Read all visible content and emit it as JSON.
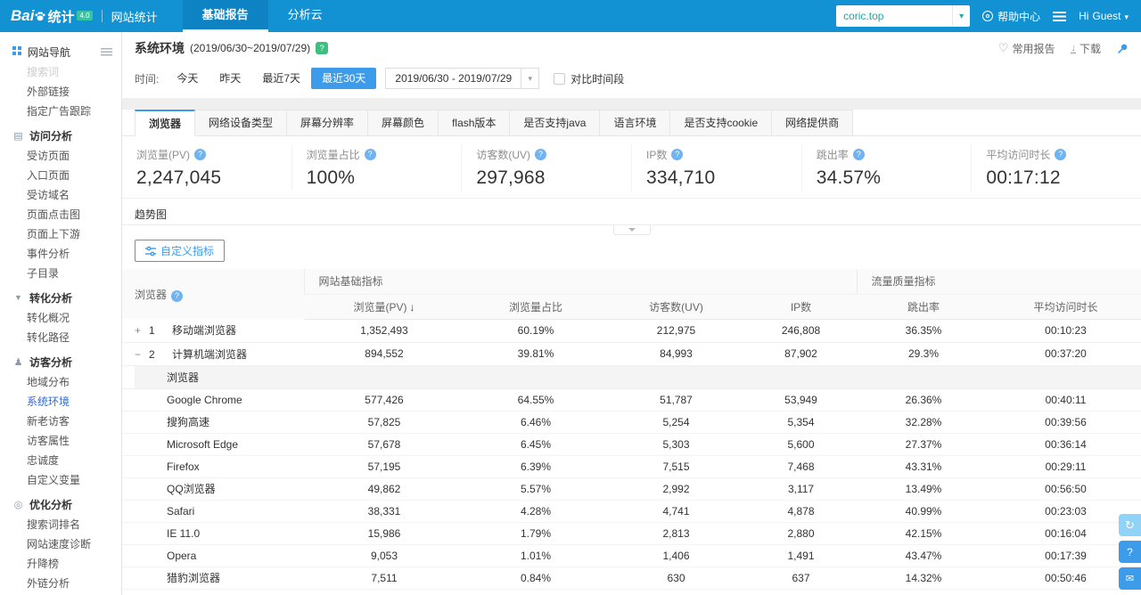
{
  "colors": {
    "header_bg": "#1292d2",
    "accent": "#3d9ce9",
    "link": "#2f6ce0",
    "green_badge": "#3fbf7f"
  },
  "header": {
    "logo_bai": "Bai",
    "logo_tongji": "统计",
    "version": "4.0",
    "product": "网站统计",
    "nav": [
      {
        "label": "基础报告",
        "active": true
      },
      {
        "label": "分析云",
        "active": false
      }
    ],
    "site": "coric.top",
    "help_center": "帮助中心",
    "greeting": "Hi",
    "user": "Guest"
  },
  "sidebar": {
    "title": "网站导航",
    "sections": [
      {
        "header": "",
        "icon": "",
        "items": [
          {
            "label": "搜索词",
            "muted": true
          },
          {
            "label": "外部链接"
          },
          {
            "label": "指定广告跟踪"
          }
        ]
      },
      {
        "header": "访问分析",
        "icon": "monitor",
        "items": [
          {
            "label": "受访页面"
          },
          {
            "label": "入口页面"
          },
          {
            "label": "受访域名"
          },
          {
            "label": "页面点击图"
          },
          {
            "label": "页面上下游"
          },
          {
            "label": "事件分析"
          },
          {
            "label": "子目录"
          }
        ]
      },
      {
        "header": "转化分析",
        "icon": "funnel",
        "items": [
          {
            "label": "转化概况"
          },
          {
            "label": "转化路径"
          }
        ]
      },
      {
        "header": "访客分析",
        "icon": "person",
        "items": [
          {
            "label": "地域分布"
          },
          {
            "label": "系统环境",
            "active": true
          },
          {
            "label": "新老访客"
          },
          {
            "label": "访客属性"
          },
          {
            "label": "忠诚度"
          },
          {
            "label": "自定义变量"
          }
        ]
      },
      {
        "header": "优化分析",
        "icon": "target",
        "items": [
          {
            "label": "搜索词排名"
          },
          {
            "label": "网站速度诊断"
          },
          {
            "label": "升降榜"
          },
          {
            "label": "外链分析"
          }
        ]
      }
    ]
  },
  "page": {
    "title": "系统环境",
    "date_range": "(2019/06/30~2019/07/29)",
    "fav_report": "常用报告",
    "download": "下载"
  },
  "filters": {
    "label": "时间:",
    "options": [
      {
        "label": "今天"
      },
      {
        "label": "昨天"
      },
      {
        "label": "最近7天"
      },
      {
        "label": "最近30天",
        "active": true
      }
    ],
    "date_value": "2019/06/30 - 2019/07/29",
    "compare": "对比时间段"
  },
  "tabs": [
    {
      "label": "浏览器",
      "active": true
    },
    {
      "label": "网络设备类型"
    },
    {
      "label": "屏幕分辨率"
    },
    {
      "label": "屏幕颜色"
    },
    {
      "label": "flash版本"
    },
    {
      "label": "是否支持java"
    },
    {
      "label": "语言环境"
    },
    {
      "label": "是否支持cookie"
    },
    {
      "label": "网络提供商"
    }
  ],
  "metrics": [
    {
      "label": "浏览量(PV)",
      "value": "2,247,045"
    },
    {
      "label": "浏览量占比",
      "value": "100%"
    },
    {
      "label": "访客数(UV)",
      "value": "297,968"
    },
    {
      "label": "IP数",
      "value": "334,710"
    },
    {
      "label": "跳出率",
      "value": "34.57%"
    },
    {
      "label": "平均访问时长",
      "value": "00:17:12"
    }
  ],
  "trend": {
    "label": "趋势图"
  },
  "custom_metric": {
    "label": "自定义指标"
  },
  "table": {
    "dim_header": "浏览器",
    "groups": [
      {
        "label": "网站基础指标",
        "span": 4
      },
      {
        "label": "流量质量指标",
        "span": 2
      }
    ],
    "columns": [
      {
        "label": "浏览量(PV)",
        "sorted": true
      },
      {
        "label": "浏览量占比"
      },
      {
        "label": "访客数(UV)"
      },
      {
        "label": "IP数"
      },
      {
        "label": "跳出率"
      },
      {
        "label": "平均访问时长"
      }
    ],
    "rows": [
      {
        "expand": "+",
        "rank": "1",
        "name": "移动端浏览器",
        "values": [
          "1,352,493",
          "60.19%",
          "212,975",
          "246,808",
          "36.35%",
          "00:10:23"
        ]
      },
      {
        "expand": "−",
        "rank": "2",
        "name": "计算机端浏览器",
        "expanded": true,
        "values": [
          "894,552",
          "39.81%",
          "84,993",
          "87,902",
          "29.3%",
          "00:37:20"
        ]
      }
    ],
    "sub_header": "浏览器",
    "sub_rows": [
      {
        "name": "Google Chrome",
        "values": [
          "577,426",
          "64.55%",
          "51,787",
          "53,949",
          "26.36%",
          "00:40:11"
        ]
      },
      {
        "name": "搜狗高速",
        "values": [
          "57,825",
          "6.46%",
          "5,254",
          "5,354",
          "32.28%",
          "00:39:56"
        ]
      },
      {
        "name": "Microsoft Edge",
        "values": [
          "57,678",
          "6.45%",
          "5,303",
          "5,600",
          "27.37%",
          "00:36:14"
        ]
      },
      {
        "name": "Firefox",
        "values": [
          "57,195",
          "6.39%",
          "7,515",
          "7,468",
          "43.31%",
          "00:29:11"
        ]
      },
      {
        "name": "QQ浏览器",
        "values": [
          "49,862",
          "5.57%",
          "2,992",
          "3,117",
          "13.49%",
          "00:56:50"
        ]
      },
      {
        "name": "Safari",
        "values": [
          "38,331",
          "4.28%",
          "4,741",
          "4,878",
          "40.99%",
          "00:23:03"
        ]
      },
      {
        "name": "IE 11.0",
        "values": [
          "15,986",
          "1.79%",
          "2,813",
          "2,880",
          "42.15%",
          "00:16:04"
        ]
      },
      {
        "name": "Opera",
        "values": [
          "9,053",
          "1.01%",
          "1,406",
          "1,491",
          "43.47%",
          "00:17:39"
        ]
      },
      {
        "name": "猎豹浏览器",
        "values": [
          "7,511",
          "0.84%",
          "630",
          "637",
          "14.32%",
          "00:50:46"
        ]
      }
    ]
  },
  "floating": [
    {
      "icon": "refresh"
    },
    {
      "icon": "service"
    },
    {
      "icon": "chat"
    }
  ]
}
